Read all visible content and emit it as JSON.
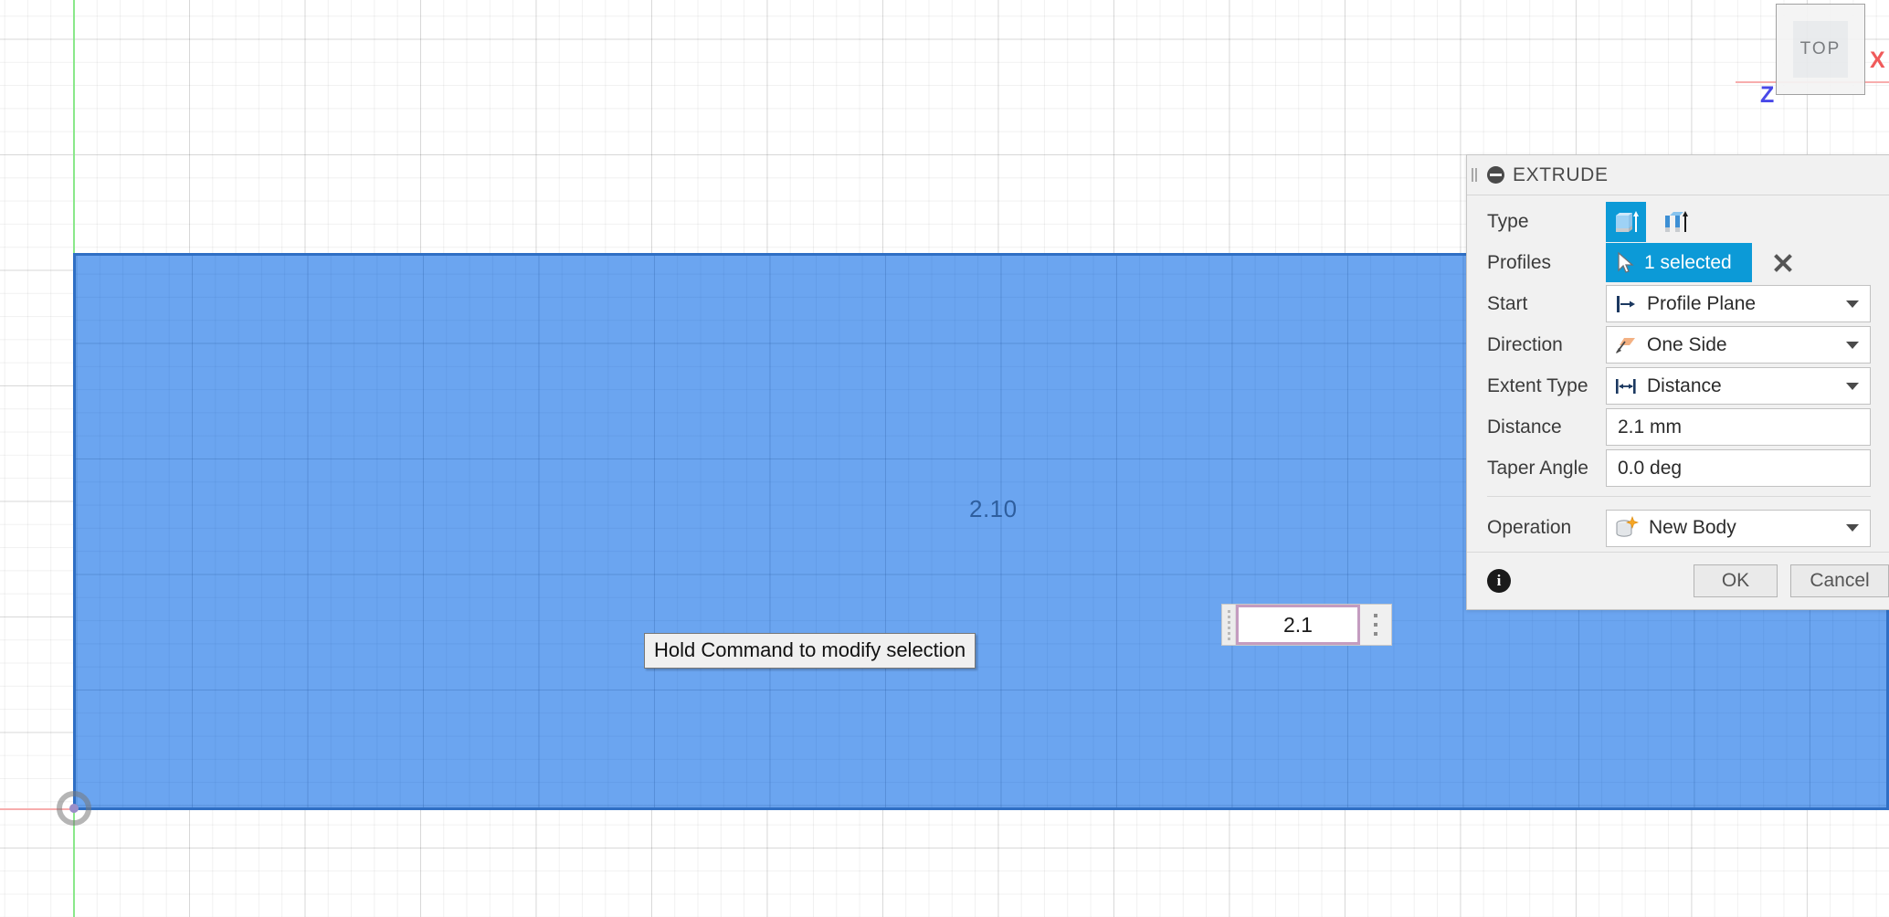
{
  "viewport": {
    "view_label": "TOP",
    "axis_labels": {
      "z": "Z",
      "x": "X"
    },
    "dimension_text": "2.10",
    "tooltip_text": "Hold Command to modify selection",
    "value_editor": {
      "value": "2.1"
    },
    "colors": {
      "selection_fill": "#6ba5f0",
      "selection_edge": "#2f6fc4",
      "accent": "#0c9ad7",
      "axis_x": "#f05a5a",
      "axis_y": "#8ae88a",
      "axis_z": "#4848e8",
      "dimension_text": "#2e5e9e"
    }
  },
  "dialog": {
    "title": "EXTRUDE",
    "rows": {
      "type": {
        "label": "Type",
        "options": [
          {
            "name": "extrude-solid-icon",
            "selected": true
          },
          {
            "name": "extrude-thin-icon",
            "selected": false
          }
        ]
      },
      "profiles": {
        "label": "Profiles",
        "selection_text": "1 selected",
        "clear_label": "Clear selection"
      },
      "start": {
        "label": "Start",
        "value": "Profile Plane"
      },
      "direction": {
        "label": "Direction",
        "value": "One Side"
      },
      "extent_type": {
        "label": "Extent Type",
        "value": "Distance"
      },
      "distance": {
        "label": "Distance",
        "value": "2.1 mm"
      },
      "taper_angle": {
        "label": "Taper Angle",
        "value": "0.0 deg"
      },
      "operation": {
        "label": "Operation",
        "value": "New Body"
      }
    },
    "footer": {
      "info_label": "i",
      "ok_label": "OK",
      "cancel_label": "Cancel"
    }
  }
}
